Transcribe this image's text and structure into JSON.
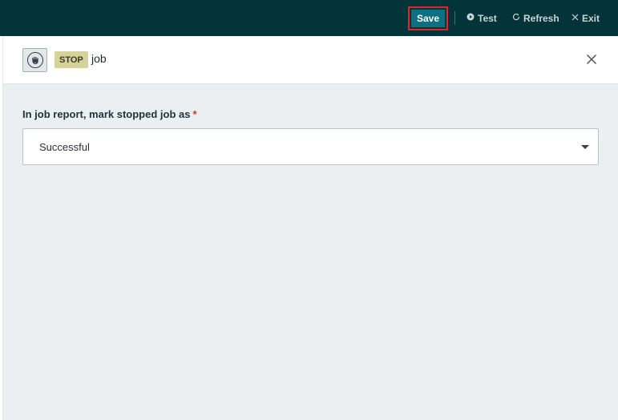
{
  "toolbar": {
    "save_label": "Save",
    "test_label": "Test",
    "refresh_label": "Refresh",
    "exit_label": "Exit",
    "test_icon": "play-circle-icon",
    "refresh_icon": "refresh-icon",
    "exit_icon": "close-icon"
  },
  "header": {
    "step_icon": "stop-hand-icon",
    "badge": "STOP",
    "step_name": "job",
    "close_icon": "close-icon"
  },
  "form": {
    "label": "In job report, mark stopped job as",
    "required_mark": "*",
    "selected_value": "Successful"
  },
  "colors": {
    "topbar": "#033439",
    "save_button": "#0b7080",
    "highlight": "#e3242b",
    "badge": "#d6d29c",
    "content_bg": "#ebeff1"
  }
}
